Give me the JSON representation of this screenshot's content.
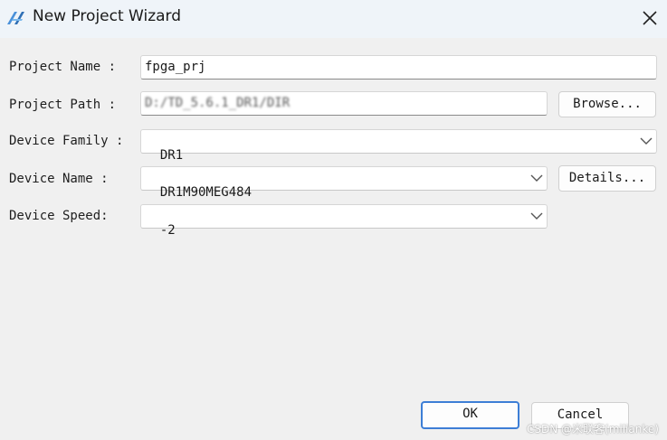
{
  "window": {
    "title": "New Project Wizard",
    "icon": "app-logo-icon",
    "close_icon": "close-icon"
  },
  "form": {
    "project_name": {
      "label": "Project Name :",
      "value": "fpga_prj"
    },
    "project_path": {
      "label": "Project Path :",
      "value": "D:/TD_5.6.1_DR1/DIR"
    },
    "device_family": {
      "label": "Device Family :",
      "value": "DR1"
    },
    "device_name": {
      "label": "Device Name :",
      "value": "DR1M90MEG484"
    },
    "device_speed": {
      "label": "Device Speed:",
      "value": "-2"
    }
  },
  "buttons": {
    "browse": "Browse...",
    "details": "Details...",
    "ok": "OK",
    "cancel": "Cancel"
  },
  "watermark": "CSDN @米联客(milianke)",
  "colors": {
    "titlebar_bg": "#eff4f9",
    "window_bg": "#f0f0f0",
    "primary_border": "#3d7ed6"
  }
}
